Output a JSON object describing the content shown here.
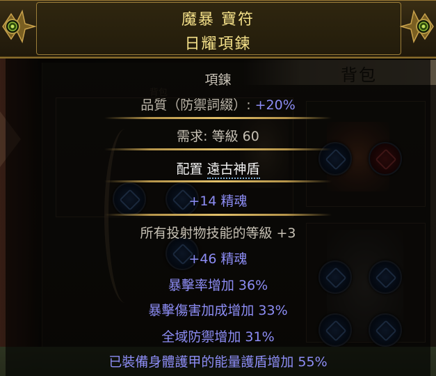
{
  "item": {
    "name": "魔暴 寶符",
    "base_type": "日耀項鍊",
    "item_class": "項鍊",
    "quality_label": "品質（防禦詞綴）: ",
    "quality_value": "+20%",
    "requirements": "需求: 等級 60",
    "anoint_label": "配置 ",
    "anoint_value": "遠古神盾",
    "implicit_mod": "+14 精魂",
    "explicit_mods": [
      "所有投射物技能的等級 +3",
      "+46 精魂",
      "暴擊率增加 36%",
      "暴擊傷害加成增加 33%",
      "全域防禦增加 31%",
      "已裝備身體護甲的能量護盾增加 55%"
    ]
  },
  "background": {
    "inventory_title": "背包",
    "ghost_label": "背包"
  },
  "colors": {
    "header_text": "#f4e089",
    "magic_mod": "#8d8df5",
    "normal_text": "#c6c0b4",
    "value_blue": "#8d8df5",
    "separator": "#b5944a"
  }
}
